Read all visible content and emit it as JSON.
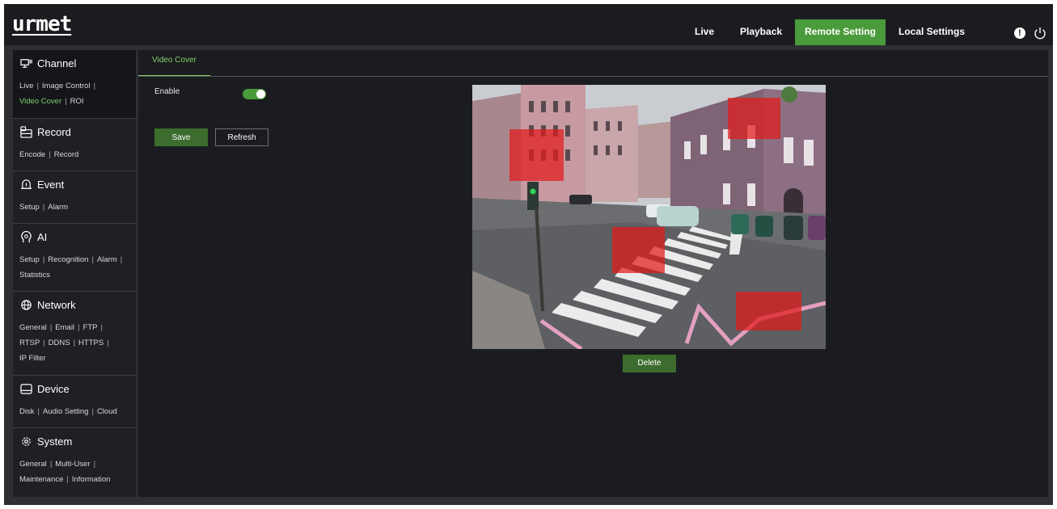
{
  "brand": {
    "logo": "urmet"
  },
  "topnav": {
    "items": [
      {
        "label": "Live"
      },
      {
        "label": "Playback"
      },
      {
        "label": "Remote Setting"
      },
      {
        "label": "Local Settings"
      }
    ],
    "active": "Remote Setting",
    "info_icon": "!"
  },
  "sidebar": {
    "channel": {
      "title": "Channel",
      "links": [
        "Live",
        "Image Control",
        "Video Cover",
        "ROI"
      ],
      "active_link": "Video Cover"
    },
    "record": {
      "title": "Record",
      "links": [
        "Encode",
        "Record"
      ]
    },
    "event": {
      "title": "Event",
      "links": [
        "Setup",
        "Alarm"
      ]
    },
    "ai": {
      "title": "AI",
      "links": [
        "Setup",
        "Recognition",
        "Alarm",
        "Statistics"
      ]
    },
    "network": {
      "title": "Network",
      "links": [
        "General",
        "Email",
        "FTP",
        "RTSP",
        "DDNS",
        "HTTPS",
        "IP Filter"
      ]
    },
    "device": {
      "title": "Device",
      "links": [
        "Disk",
        "Audio Setting",
        "Cloud"
      ]
    },
    "system": {
      "title": "System",
      "links": [
        "General",
        "Multi-User",
        "Maintenance",
        "Information"
      ]
    }
  },
  "main": {
    "tab": "Video Cover",
    "enable_label": "Enable",
    "enabled": true,
    "save_label": "Save",
    "refresh_label": "Refresh",
    "delete_label": "Delete",
    "mask_count": 4
  },
  "colors": {
    "accent": "#4a9b3b",
    "accent_text": "#7fd06b",
    "mask": "#e21b1b"
  }
}
